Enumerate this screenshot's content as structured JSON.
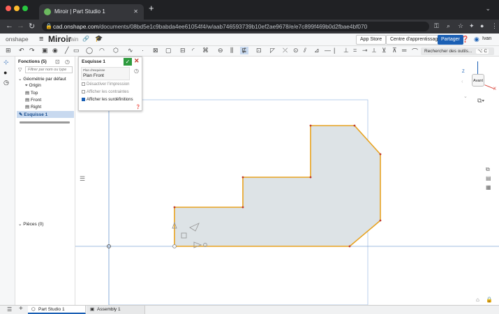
{
  "browser": {
    "tab_title": "Miroir | Part Studio 1",
    "url_host": "cad.onshape.com",
    "url_path": "/documents/08bd5e1c9babda4ee61054f4/w/aab746593739b10ef2ae9678/e/e7c899f469b0d2fbae4bf070"
  },
  "app": {
    "logo": "onshape",
    "doc_name": "Miroir",
    "branch": "Main",
    "app_store": "App Store",
    "learning": "Centre d'apprentissage",
    "share": "Partager",
    "user": "Ivan",
    "search_tools": "Rechercher des outils...",
    "search_shortcut": "⌥ C"
  },
  "features": {
    "title": "Fonctions (5)",
    "filter_placeholder": "Filtrer par nom ou type",
    "group": "Géométrie par défaut",
    "items": [
      "Origin",
      "Top",
      "Front",
      "Right"
    ],
    "sketch": "Esquisse 1",
    "parts": "Pièces (0)"
  },
  "sketch_dialog": {
    "title": "Esquisse 1",
    "plane_label": "Plan d'esquisse",
    "plane_value": "Plan Front",
    "opt1": "Désactiver l'impression",
    "opt2": "Afficher les contraintes",
    "opt3": "Afficher les surdéfinitions"
  },
  "viewcube": {
    "face": "Avant",
    "axis_z": "Z",
    "axis_x": "X"
  },
  "bottom_tabs": [
    "Part Studio 1",
    "Assembly 1"
  ],
  "colors": {
    "sketch_stroke": "#e8a21e",
    "sketch_fill": "#dde3e6",
    "vertex": "#c0392b",
    "axis": "#7fa6d6",
    "accent": "#1a5fb4"
  }
}
